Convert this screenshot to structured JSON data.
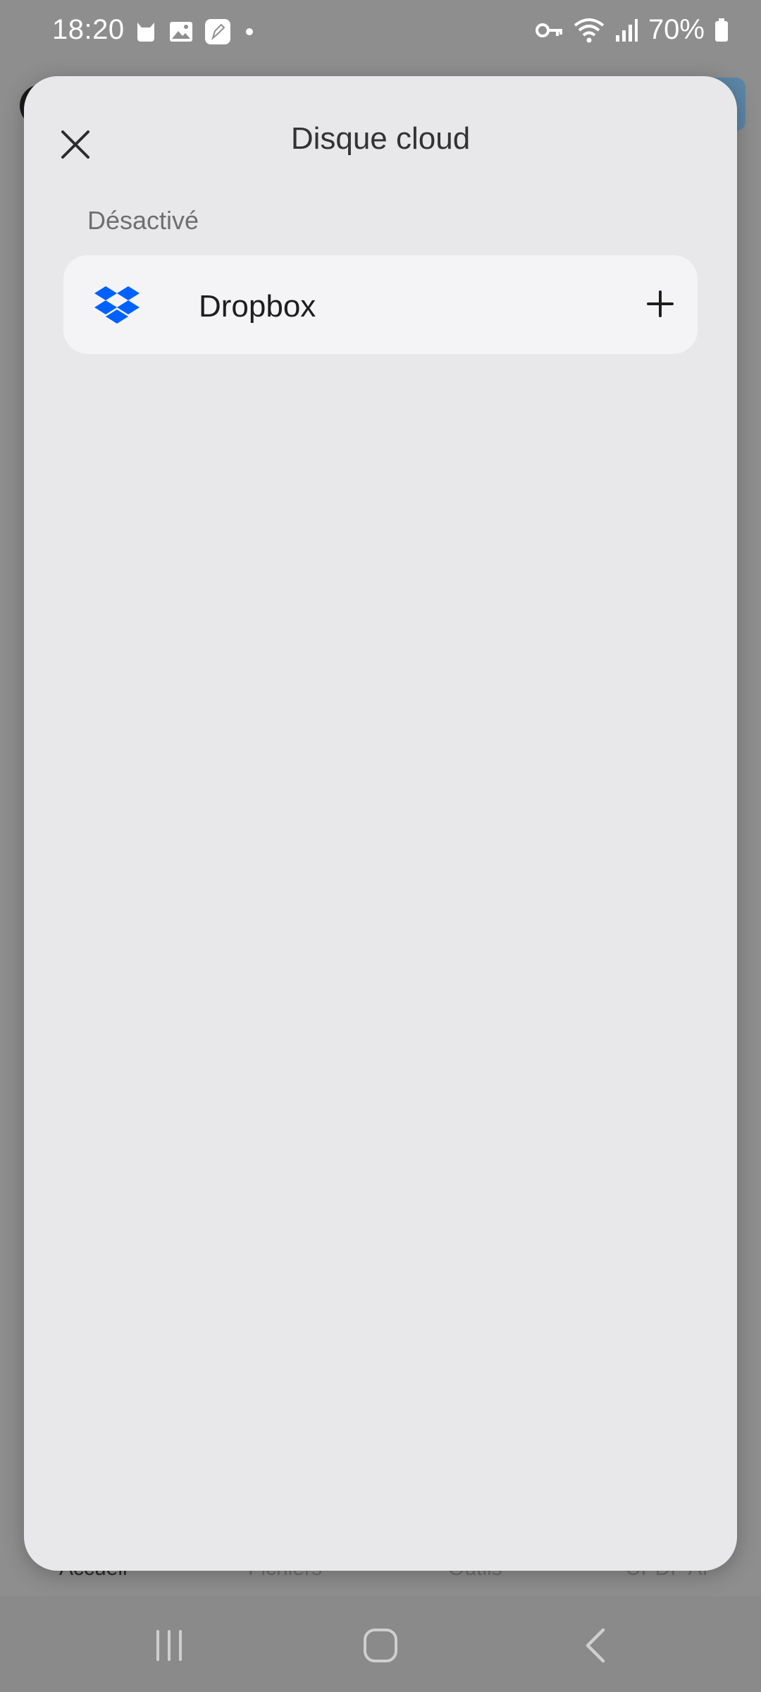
{
  "status_bar": {
    "time": "18:20",
    "battery": "70%",
    "left_icons": [
      "cat-notification-icon",
      "gallery-icon",
      "note-app-icon",
      "dot-icon"
    ],
    "right_icons": [
      "vpn-key-icon",
      "wifi-icon",
      "signal-icon",
      "battery-icon"
    ]
  },
  "sheet": {
    "title": "Disque cloud",
    "section_label": "Désactivé",
    "items": [
      {
        "label": "Dropbox",
        "icon": "dropbox-icon",
        "action_icon": "add-icon"
      }
    ]
  },
  "background_tabs": [
    "Accueil",
    "Fichiers",
    "Outils",
    "UPDF AI"
  ],
  "colors": {
    "sheet_background": "#e8e8ea",
    "row_background": "#f4f4f6",
    "dropbox_blue": "#0061fe",
    "dim_background": "#8e8e8e"
  },
  "nav_bar": [
    "recent-apps-icon",
    "home-icon",
    "back-icon"
  ]
}
